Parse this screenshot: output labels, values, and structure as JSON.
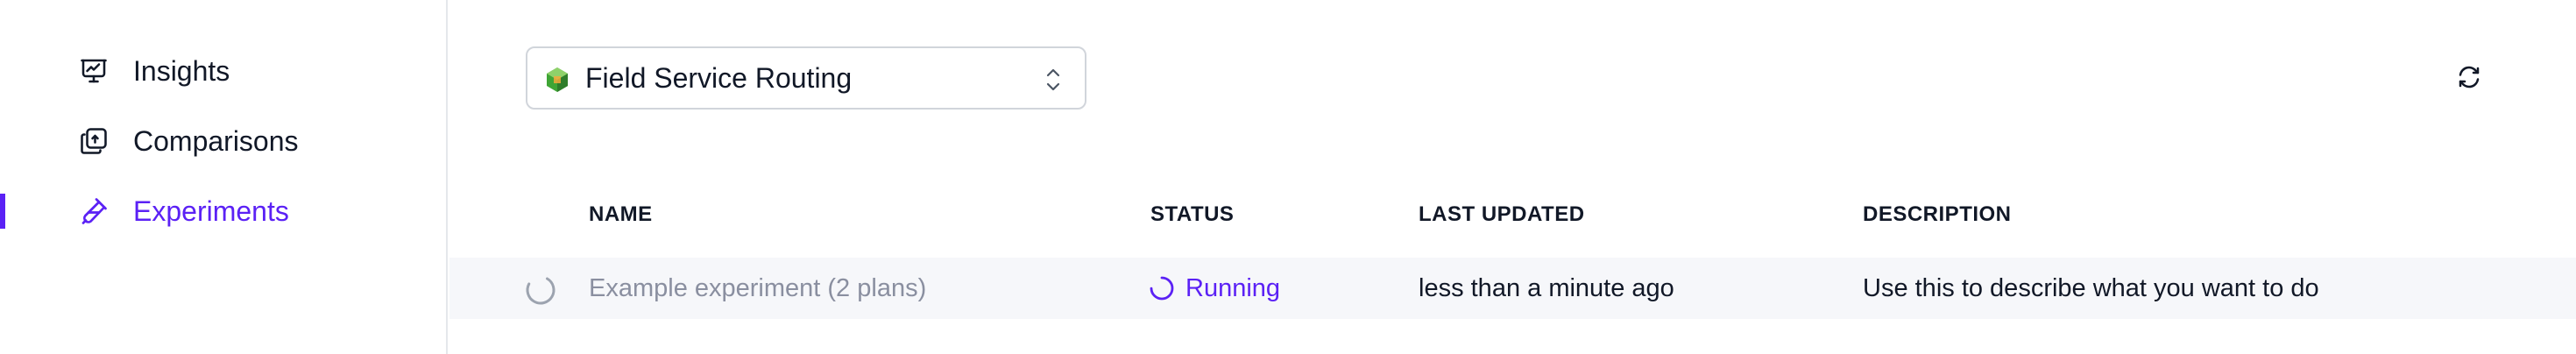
{
  "sidebar": {
    "items": [
      {
        "label": "Insights",
        "icon": "presentation-chart-icon",
        "active": false
      },
      {
        "label": "Comparisons",
        "icon": "compare-icon",
        "active": false
      },
      {
        "label": "Experiments",
        "icon": "experiment-icon",
        "active": true
      }
    ],
    "accent_color": "#5b21f5"
  },
  "header": {
    "project_selector": {
      "value": "Field Service Routing",
      "icon": "cube-icon",
      "chevron": "chevron-up-down-icon"
    },
    "refresh_icon": "refresh-icon"
  },
  "table": {
    "columns": [
      "NAME",
      "STATUS",
      "LAST UPDATED",
      "DESCRIPTION"
    ],
    "rows": [
      {
        "name": "Example experiment (2 plans)",
        "status": "Running",
        "last_updated": "less than a minute ago",
        "description": "Use this to describe what you want to do"
      }
    ]
  }
}
